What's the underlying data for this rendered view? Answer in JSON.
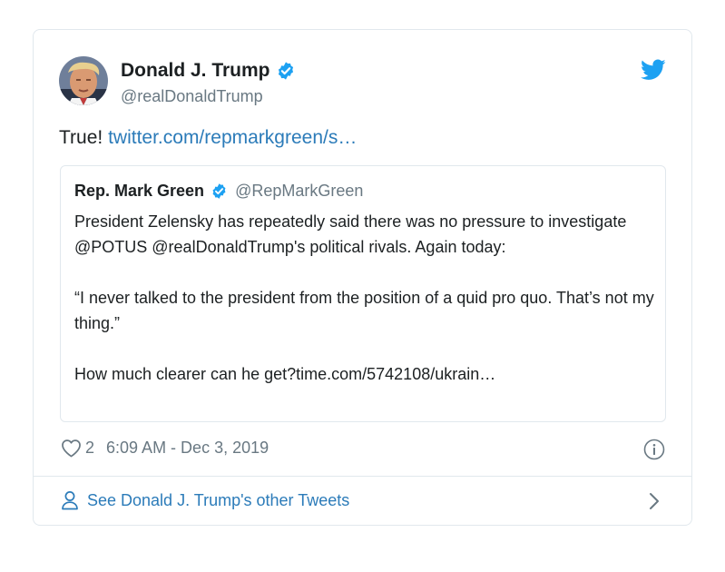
{
  "tweet": {
    "author": {
      "name": "Donald J. Trump",
      "handle": "@realDonaldTrump",
      "verified": true
    },
    "text": "True!",
    "link_text": "twitter.com/repmarkgreen/s…",
    "quoted": {
      "author_name": "Rep. Mark Green",
      "handle": "@RepMarkGreen",
      "verified": true,
      "paragraph_1": "President Zelensky has repeatedly said there was no pressure to investigate @POTUS @realDonaldTrump's political rivals. Again today:",
      "paragraph_2": "“I never talked to the president from the position of a quid pro quo. That’s not my thing.”",
      "paragraph_3": "How much clearer can he get?time.com/5742108/ukrain…"
    },
    "likes": "2",
    "timestamp": "6:09 AM - Dec 3, 2019",
    "footer_link": "See Donald J. Trump's other Tweets"
  },
  "icons": {
    "brand": "twitter-bird-icon",
    "verified": "verified-badge-icon",
    "like": "heart-icon",
    "info": "info-icon",
    "profile": "person-icon",
    "chevron": "chevron-right-icon"
  },
  "colors": {
    "twitter_blue": "#1da1f2",
    "link": "#2b7bb9",
    "muted": "#697882",
    "border": "#e1e8ed",
    "text": "#1c2022"
  }
}
